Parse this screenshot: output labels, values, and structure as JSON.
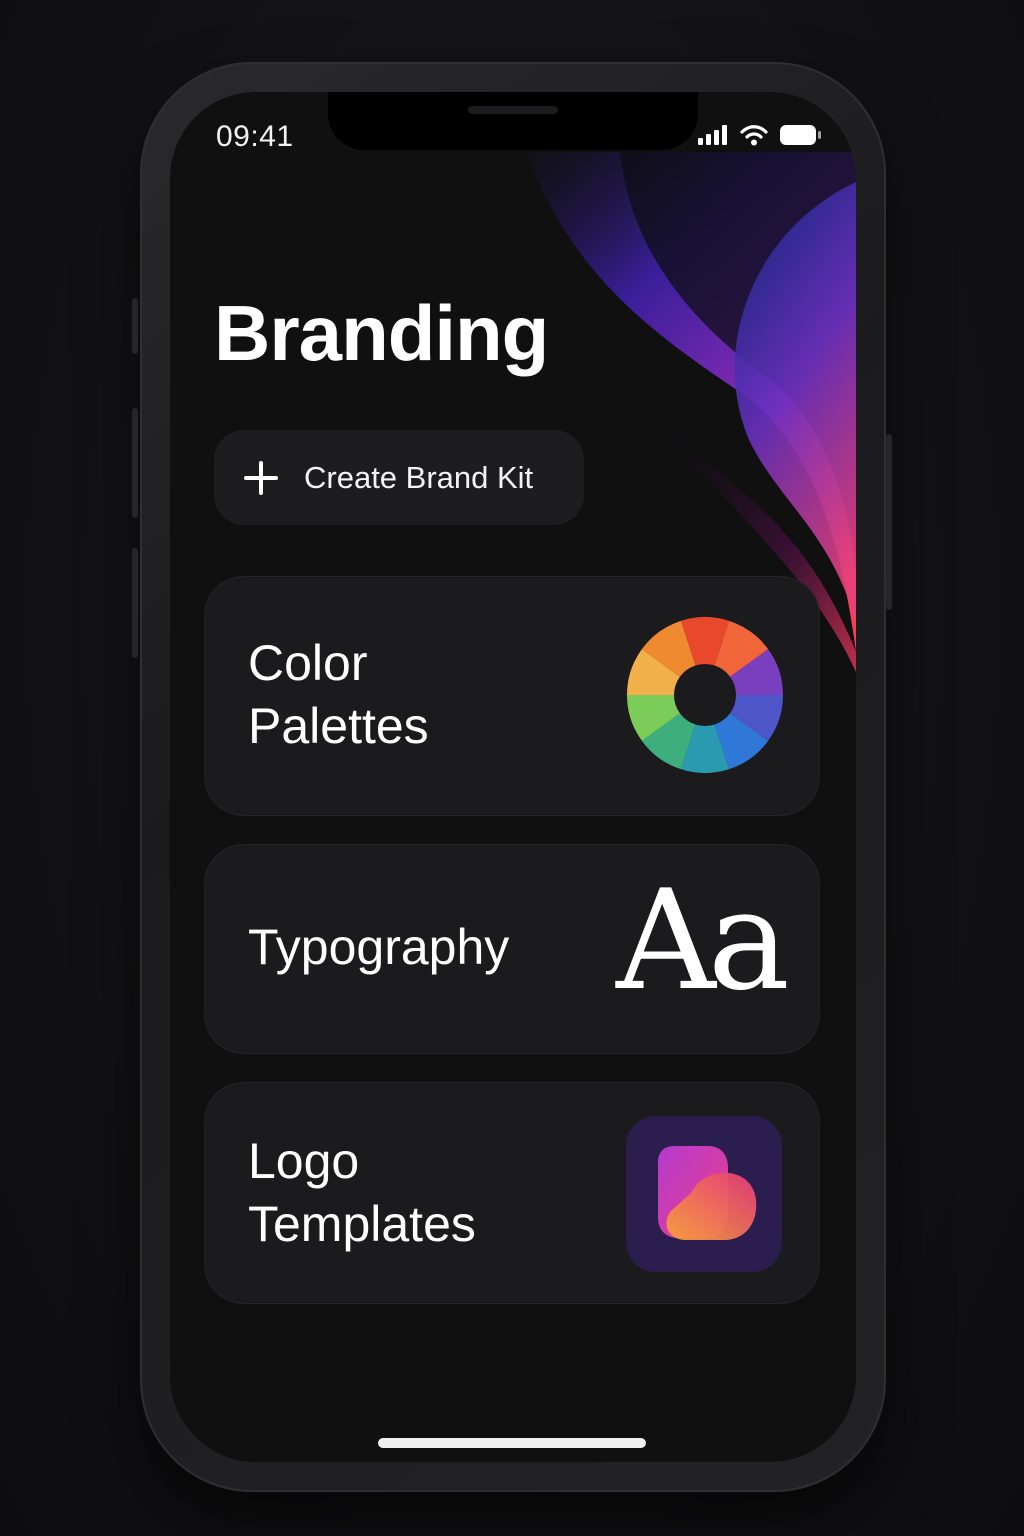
{
  "status_bar": {
    "time": "09:41",
    "icons": [
      "signal-bars-icon",
      "wifi-icon",
      "battery-icon"
    ]
  },
  "header": {
    "title": "Branding"
  },
  "actions": {
    "create_label": "Create Brand Kit",
    "create_icon": "plus-icon"
  },
  "cards": [
    {
      "title_line1": "Color",
      "title_line2": "Palettes",
      "icon": "color-wheel-icon"
    },
    {
      "title_line1": "Typography",
      "glyph": "Aa",
      "icon": "font-glyph-icon"
    },
    {
      "title_line1": "Logo",
      "title_line2": "Templates",
      "icon": "logo-template-icon"
    }
  ],
  "colors": {
    "background": "#101011",
    "card": "#1b1b1e",
    "button": "#1d1d20",
    "text": "#ffffff",
    "accent_purple": "#5b2bd1",
    "accent_pink": "#e0357a",
    "accent_orange": "#f2504a",
    "logo_tile": "#2b1e4e"
  }
}
